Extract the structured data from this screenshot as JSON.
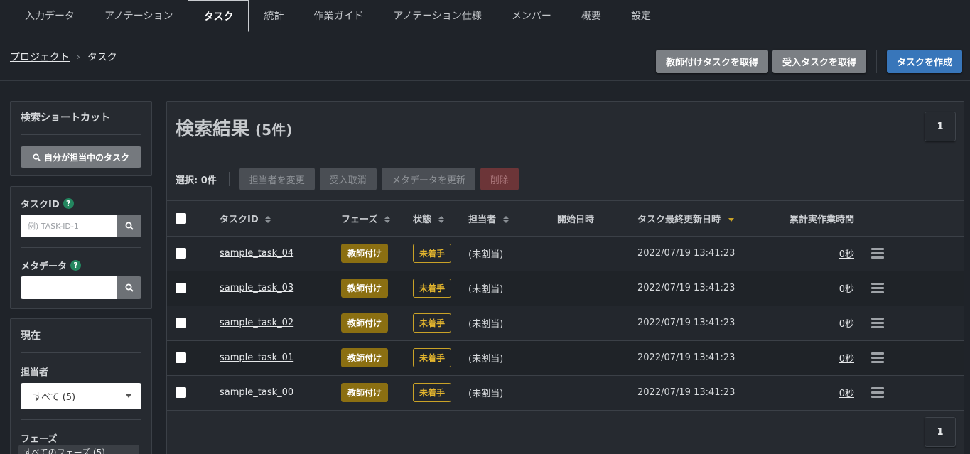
{
  "tabs": [
    {
      "label": "入力データ"
    },
    {
      "label": "アノテーション"
    },
    {
      "label": "タスク"
    },
    {
      "label": "統計"
    },
    {
      "label": "作業ガイド"
    },
    {
      "label": "アノテーション仕様"
    },
    {
      "label": "メンバー"
    },
    {
      "label": "概要"
    },
    {
      "label": "設定"
    }
  ],
  "active_tab": "タスク",
  "breadcrumb": {
    "project": "プロジェクト",
    "current": "タスク"
  },
  "header_buttons": {
    "get_annotation_task": "教師付けタスクを取得",
    "get_acceptance_task": "受入タスクを取得",
    "create_task": "タスクを作成"
  },
  "sidebar": {
    "shortcuts_title": "検索ショートカット",
    "my_tasks_button": "自分が担当中のタスク",
    "task_id_label": "タスクID",
    "task_id_placeholder": "例) TASK-ID-1",
    "metadata_label": "メタデータ",
    "current_title": "現在",
    "assignee_label": "担当者",
    "assignee_value": "すべて (5)",
    "phase_label": "フェーズ",
    "phase_value": "すべてのフェーズ (5)"
  },
  "results": {
    "title": "検索結果",
    "count": "(5件)",
    "page": "1",
    "selected_label": "選択: 0件",
    "bulk_actions": {
      "change_assignee": "担当者を変更",
      "cancel_acceptance": "受入取消",
      "update_metadata": "メタデータを更新",
      "delete": "削除"
    }
  },
  "table": {
    "columns": {
      "task_id": "タスクID",
      "phase": "フェーズ",
      "status": "状態",
      "assignee": "担当者",
      "start_date": "開始日時",
      "updated_at": "タスク最終更新日時",
      "work_time": "累計実作業時間"
    },
    "rows": [
      {
        "task_id": "sample_task_04",
        "phase": "教師付け",
        "status": "未着手",
        "assignee": "(未割当)",
        "updated_at": "2022/07/19 13:41:23",
        "work_time": "0秒"
      },
      {
        "task_id": "sample_task_03",
        "phase": "教師付け",
        "status": "未着手",
        "assignee": "(未割当)",
        "updated_at": "2022/07/19 13:41:23",
        "work_time": "0秒"
      },
      {
        "task_id": "sample_task_02",
        "phase": "教師付け",
        "status": "未着手",
        "assignee": "(未割当)",
        "updated_at": "2022/07/19 13:41:23",
        "work_time": "0秒"
      },
      {
        "task_id": "sample_task_01",
        "phase": "教師付け",
        "status": "未着手",
        "assignee": "(未割当)",
        "updated_at": "2022/07/19 13:41:23",
        "work_time": "0秒"
      },
      {
        "task_id": "sample_task_00",
        "phase": "教師付け",
        "status": "未着手",
        "assignee": "(未割当)",
        "updated_at": "2022/07/19 13:41:23",
        "work_time": "0秒"
      }
    ]
  },
  "colors": {
    "accent_blue": "#3876ba",
    "phase_badge": "#8b6f12",
    "status_border": "#c9a227",
    "help_icon": "#23865f"
  }
}
